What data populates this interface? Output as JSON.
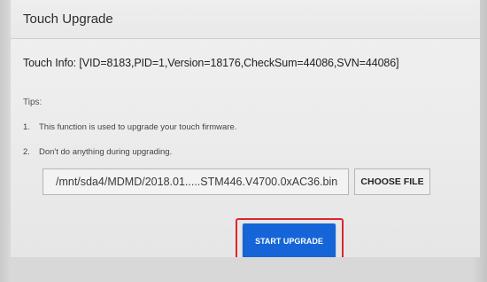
{
  "dialog": {
    "title": "Touch Upgrade",
    "touch_info": "Touch Info: [VID=8183,PID=1,Version=18176,CheckSum=44086,SVN=44086]",
    "tips_label": "Tips:",
    "tips": [
      {
        "num": "1.",
        "text": "This function is used to upgrade your touch firmware."
      },
      {
        "num": "2.",
        "text": "Don't do anything during upgrading."
      }
    ],
    "file_path": "/mnt/sda4/MDMD/2018.01.....STM446.V4700.0xAC36.bin",
    "choose_file_label": "CHOOSE FILE",
    "start_upgrade_label": "START UPGRADE"
  },
  "colors": {
    "primary_button": "#1565d8",
    "highlight_box": "#e0242c"
  }
}
